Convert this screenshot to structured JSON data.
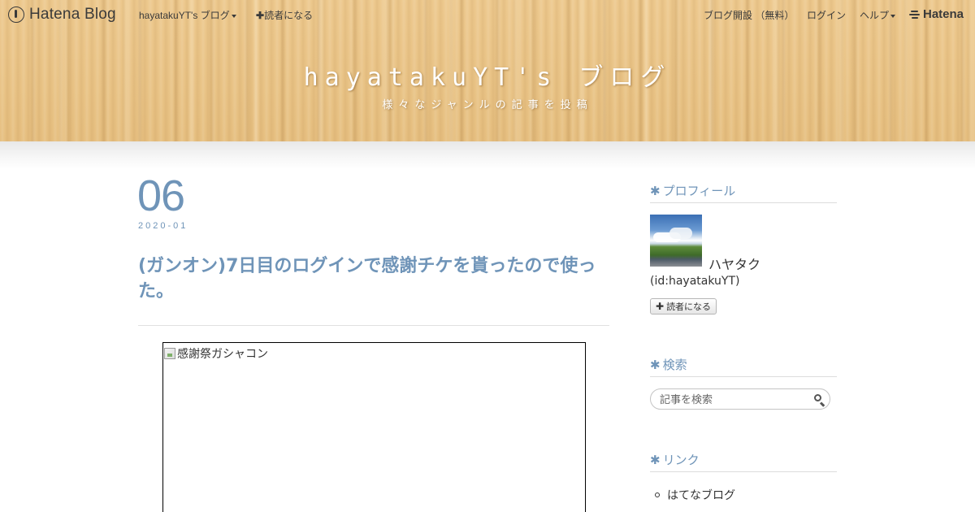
{
  "header": {
    "logo_text": "Hatena Blog",
    "blog_menu_label": "hayatakuYT's ブログ",
    "subscribe_label": "読者になる",
    "open_blog_label": "ブログ開設 （無料）",
    "login_label": "ログイン",
    "help_label": "ヘルプ",
    "hatena_label": "Hatena",
    "blog_title": "hayatakuYT's ブログ",
    "blog_description": "様々なジャンルの記事を投稿"
  },
  "entry": {
    "date_day": "06",
    "date_year_month": "2020-01",
    "title": "(ガンオン)7日目のログインで感謝チケを貰ったので使った。",
    "image_alt": "感謝祭ガシャコン"
  },
  "sidebar": {
    "profile": {
      "heading": "プロフィール",
      "name": "ハヤタク",
      "id": "(id:hayatakuYT)",
      "follow_label": "読者になる"
    },
    "search": {
      "heading": "検索",
      "placeholder": "記事を検索"
    },
    "links": {
      "heading": "リンク",
      "items": [
        "はてなブログ"
      ]
    }
  },
  "colors": {
    "accent": "#6f94b8",
    "header_wood": "#e9c488",
    "text": "#333333"
  }
}
